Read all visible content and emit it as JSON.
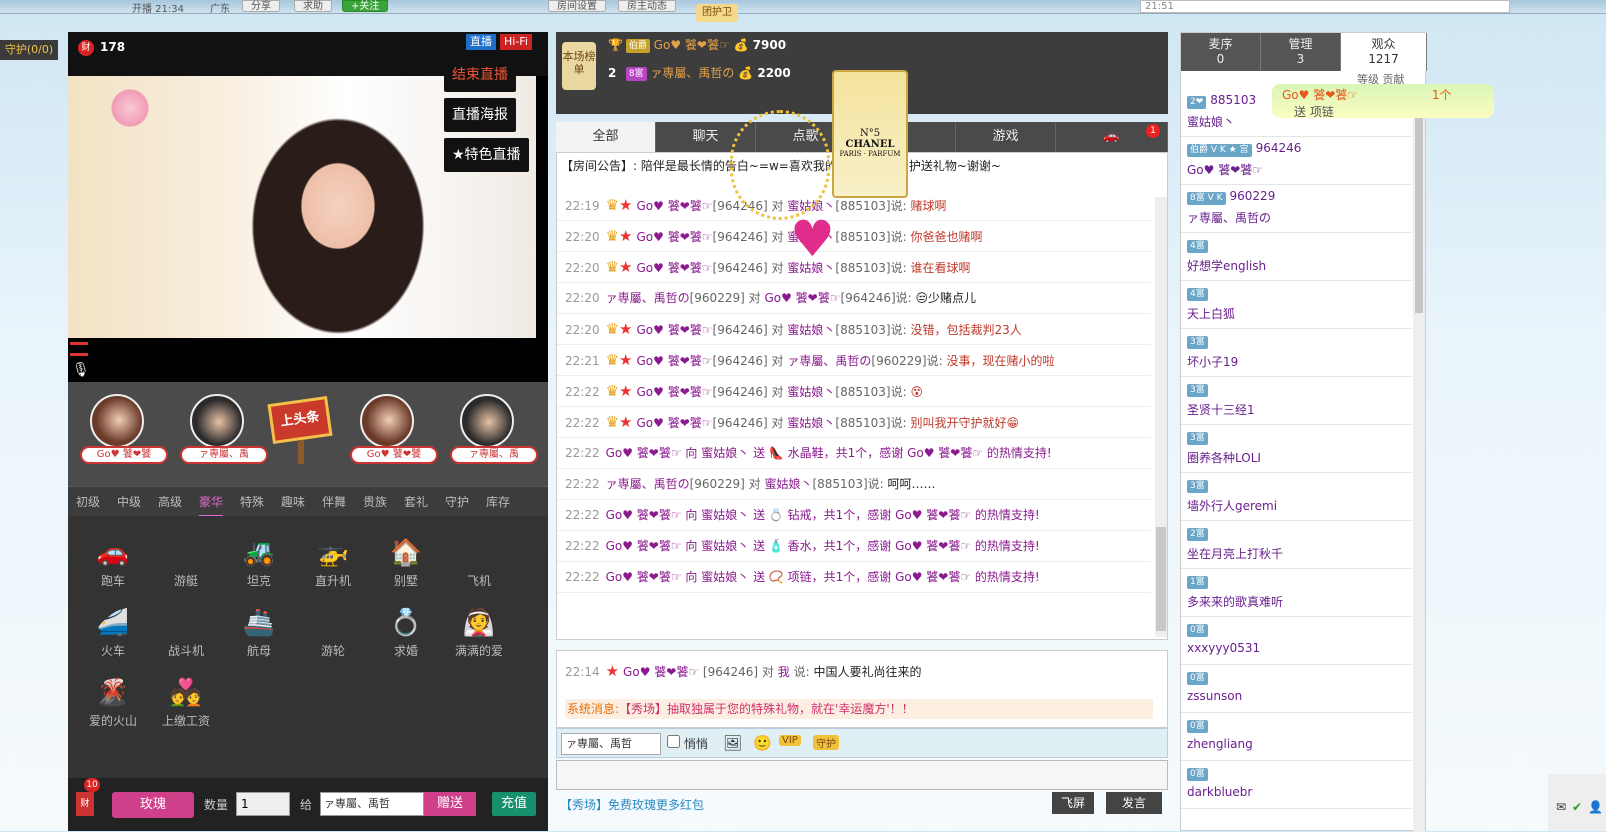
{
  "top": {
    "time": "开播 21:34",
    "location": "广东",
    "share": "分享",
    "help": "求助",
    "follow": "+关注",
    "guard_badge": "团护卫",
    "btn_a": "房间设置",
    "btn_b": "房主动态",
    "right_time": "21:51"
  },
  "guard": {
    "label": "守护(0/0)"
  },
  "video": {
    "wealth": "178",
    "live": "直播",
    "hifi": "Hi-Fi",
    "end_live": "结束直播",
    "poster": "直播海报",
    "special": "★特色直播"
  },
  "mic": {
    "slots": [
      "Go♥ 饕❤饕",
      "ァ専屬、禹",
      "Go♥ 饕❤饕",
      "ァ専屬、禹"
    ],
    "headline": "上头条"
  },
  "gift_tabs": [
    "初级",
    "中级",
    "高级",
    "豪华",
    "特殊",
    "趣味",
    "伴舞",
    "贵族",
    "套礼",
    "守护",
    "库存"
  ],
  "gifts": [
    {
      "icon": "🚗",
      "label": "跑车"
    },
    {
      "icon": "🛥",
      "label": "游艇"
    },
    {
      "icon": "🚜",
      "label": "坦克"
    },
    {
      "icon": "🚁",
      "label": "直升机"
    },
    {
      "icon": "🏠",
      "label": "别墅"
    },
    {
      "icon": "✈",
      "label": "飞机"
    },
    {
      "icon": "🚄",
      "label": "火车"
    },
    {
      "icon": "✈",
      "label": "战斗机"
    },
    {
      "icon": "🚢",
      "label": "航母"
    },
    {
      "icon": "⛴",
      "label": "游轮"
    },
    {
      "icon": "💍",
      "label": "求婚"
    },
    {
      "icon": "👰",
      "label": "满满的爱"
    },
    {
      "icon": "🌋",
      "label": "爱的火山"
    },
    {
      "icon": "💑",
      "label": "上缴工资"
    }
  ],
  "send": {
    "bag_count": "10",
    "gift": "玫瑰",
    "qty_label": "数量",
    "qty": "1",
    "give_label": "给",
    "target": "ァ専屬、禹哲",
    "send_btn": "赠送",
    "recharge": "充值"
  },
  "rank": {
    "badge": "本场榜单",
    "rows": [
      {
        "no": "",
        "level": "伯爵",
        "name": "Go♥ 饕❤饕☞",
        "value": "7900"
      },
      {
        "no": "2",
        "level": "8富",
        "name": "ァ専屬、禹哲の",
        "value": "2200"
      }
    ]
  },
  "tabs": [
    "全部",
    "聊天",
    "点歌",
    "",
    "游戏",
    ""
  ],
  "tab_badge": "1",
  "announce": "【房间公告】: 陪伴是最长情的告白~=w=喜欢我的宝宝们多多守护送礼物~谢谢~",
  "messages": [
    {
      "time": "22:19",
      "from": "Go♥ 饕❤饕☞",
      "fid": "[964246]",
      "to": "蜜姑娘丶",
      "tid": "[885103]",
      "text": "赌球啊",
      "kind": "say"
    },
    {
      "time": "22:20",
      "from": "Go♥ 饕❤饕☞",
      "fid": "[964246]",
      "to": "蜜姑娘丶",
      "tid": "[885103]",
      "text": "你爸爸也赌啊",
      "kind": "say"
    },
    {
      "time": "22:20",
      "from": "Go♥ 饕❤饕☞",
      "fid": "[964246]",
      "to": "蜜姑娘丶",
      "tid": "[885103]",
      "text": "谁在看球啊",
      "kind": "say"
    },
    {
      "time": "22:20",
      "from": "ァ専屬、禹哲の",
      "fid": "[960229]",
      "to": "Go♥ 饕❤饕☞",
      "tid": "[964246]",
      "text": "😒少赌点儿",
      "kind": "plain"
    },
    {
      "time": "22:20",
      "from": "Go♥ 饕❤饕☞",
      "fid": "[964246]",
      "to": "蜜姑娘丶",
      "tid": "[885103]",
      "text": "没错，包括裁判23人",
      "kind": "say"
    },
    {
      "time": "22:21",
      "from": "Go♥ 饕❤饕☞",
      "fid": "[964246]",
      "to": "ァ専屬、禹哲の",
      "tid": "[960229]",
      "text": "没事，现在赌小的啦",
      "kind": "say"
    },
    {
      "time": "22:22",
      "from": "Go♥ 饕❤饕☞",
      "fid": "[964246]",
      "to": "蜜姑娘丶",
      "tid": "[885103]",
      "text": "😵",
      "kind": "say"
    },
    {
      "time": "22:22",
      "from": "Go♥ 饕❤饕☞",
      "fid": "[964246]",
      "to": "蜜姑娘丶",
      "tid": "[885103]",
      "text": "别叫我开守护就好😁",
      "kind": "say"
    },
    {
      "time": "22:22",
      "line": "Go♥ 饕❤饕☞ 向 蜜姑娘丶 送 👠 水晶鞋，共1个，感谢 Go♥ 饕❤饕☞ 的热情支持!",
      "kind": "gift"
    },
    {
      "time": "22:22",
      "from": "ァ専屬、禹哲の",
      "fid": "[960229]",
      "to": "蜜姑娘丶",
      "tid": "[885103]",
      "text": "呵呵……",
      "kind": "plain"
    },
    {
      "time": "22:22",
      "line": "Go♥ 饕❤饕☞ 向 蜜姑娘丶 送 💍 钻戒，共1个，感谢 Go♥ 饕❤饕☞ 的热情支持!",
      "kind": "gift"
    },
    {
      "time": "22:22",
      "line": "Go♥ 饕❤饕☞ 向 蜜姑娘丶 送 🧴 香水，共1个，感谢 Go♥ 饕❤饕☞ 的热情支持!",
      "kind": "gift"
    },
    {
      "time": "22:22",
      "line": "Go♥ 饕❤饕☞ 向 蜜姑娘丶 送 📿 项链，共1个，感谢 Go♥ 饕❤饕☞ 的热情支持!",
      "kind": "gift"
    }
  ],
  "private_msg": {
    "time": "22:14",
    "from": "Go♥ 饕❤饕☞",
    "fid": "[964246]",
    "to": "我",
    "text": "中国人要礼尚往来的"
  },
  "sys": {
    "label": "系统消息:",
    "text": "【秀场】抽取独属于您的特殊礼物，就在'幸运魔方'！！"
  },
  "input": {
    "target": "ァ専屬、禹哲",
    "whisper": "悄悄",
    "link": "【秀场】免费玫瑰更多红包",
    "fly": "飞屏",
    "speak": "发言"
  },
  "right": {
    "tabs": [
      {
        "label": "麦序",
        "count": "0"
      },
      {
        "label": "管理",
        "count": "3"
      },
      {
        "label": "观众",
        "count": "1217"
      }
    ],
    "sort": "等级 贡献",
    "users": [
      {
        "badge": "2❤",
        "id": "885103",
        "name": "蜜姑娘丶"
      },
      {
        "badge": "伯爵 V K ★ 宫",
        "id": "964246",
        "name": "Go♥ 饕❤饕☞"
      },
      {
        "badge": "8富 V K",
        "id": "960229",
        "name": "ァ専屬、禹哲の"
      },
      {
        "badge": "4富",
        "id": "",
        "name": "好想学english"
      },
      {
        "badge": "4富",
        "id": "",
        "name": "天上白狐"
      },
      {
        "badge": "3富",
        "id": "",
        "name": "坏小子19"
      },
      {
        "badge": "3富",
        "id": "",
        "name": "圣贤十三经1"
      },
      {
        "badge": "3富",
        "id": "",
        "name": "圈养各种LOLI"
      },
      {
        "badge": "3富",
        "id": "",
        "name": "墙外行人geremi"
      },
      {
        "badge": "2富",
        "id": "",
        "name": "坐在月亮上打秋千"
      },
      {
        "badge": "1富",
        "id": "",
        "name": "多来来的歌真难听"
      },
      {
        "badge": "0富",
        "id": "",
        "name": "xxxyyy0531"
      },
      {
        "badge": "0富",
        "id": "",
        "name": "zssunson"
      },
      {
        "badge": "0富",
        "id": "",
        "name": "zhengliang"
      },
      {
        "badge": "0富",
        "id": "",
        "name": "darkbluebr"
      }
    ]
  },
  "toast": {
    "from": "Go♥ 饕❤饕☞",
    "action": "送 项链",
    "count": "1个"
  },
  "perfume": {
    "brand": "CHANEL",
    "number": "N°5",
    "sub": "PARIS · PARFUM"
  }
}
